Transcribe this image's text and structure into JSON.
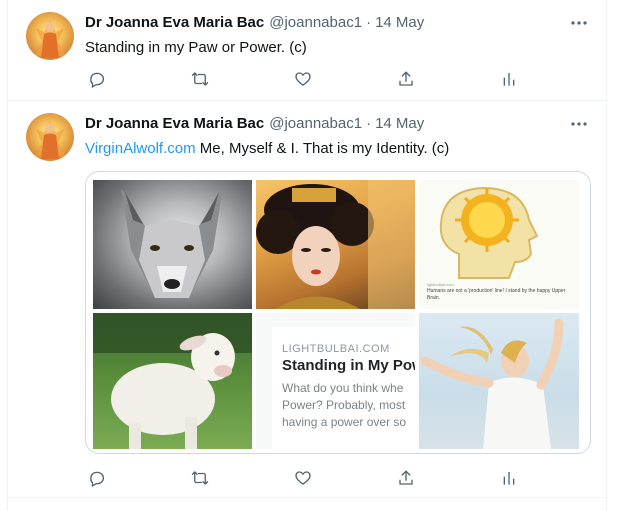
{
  "tweets": [
    {
      "author_name": "Dr Joanna Eva Maria Bac",
      "handle": "@joannabac1",
      "separator": "·",
      "date": "14 May",
      "text": "Standing in my Paw or Power. (c)"
    },
    {
      "author_name": "Dr Joanna Eva Maria Bac",
      "handle": "@joannabac1",
      "separator": "·",
      "date": "14 May",
      "link": "VirginAlwolf.com",
      "text": " Me, Myself & I. That is my Identity. (c)",
      "media": {
        "card": {
          "source": "LIGHTBULBAI.COM",
          "title": "Standing in My Powe",
          "desc_lines": [
            "What do you think whe",
            "Power? Probably, most",
            "having a power over so"
          ]
        },
        "head_image": {
          "source": "lightbulbai.com",
          "caption": "Humans are not a 'production' line! I stand by the happy Upper Brain."
        }
      }
    }
  ],
  "icons": [
    "reply-icon",
    "retweet-icon",
    "like-icon",
    "share-icon",
    "analytics-icon",
    "more-icon"
  ],
  "colors": {
    "link": "#1d9bf0",
    "muted": "#536471",
    "border": "#eff3f4"
  }
}
